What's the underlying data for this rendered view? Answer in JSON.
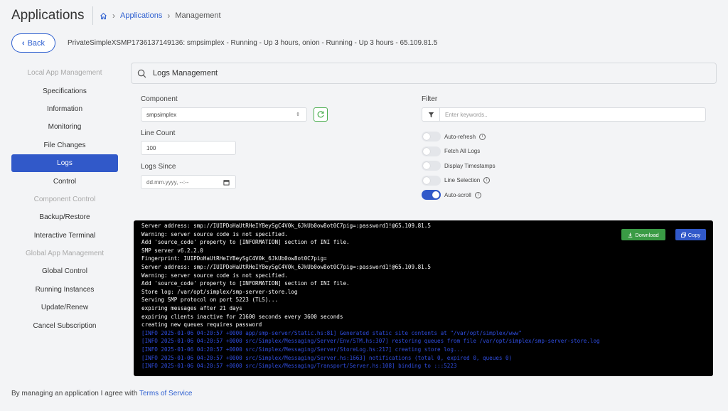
{
  "header": {
    "title": "Applications",
    "breadcrumb": {
      "link": "Applications",
      "current": "Management"
    }
  },
  "instance": {
    "back_label": "Back",
    "info": "PrivateSimpleXSMP1736137149136: smpsimplex - Running - Up 3 hours, onion - Running - Up 3 hours - 65.109.81.5"
  },
  "sidebar": {
    "items": [
      {
        "label": "Local App Management",
        "type": "header"
      },
      {
        "label": "Specifications",
        "type": "item"
      },
      {
        "label": "Information",
        "type": "item"
      },
      {
        "label": "Monitoring",
        "type": "item"
      },
      {
        "label": "File Changes",
        "type": "item"
      },
      {
        "label": "Logs",
        "type": "active"
      },
      {
        "label": "Control",
        "type": "item"
      },
      {
        "label": "Component Control",
        "type": "header"
      },
      {
        "label": "Backup/Restore",
        "type": "item"
      },
      {
        "label": "Interactive Terminal",
        "type": "item"
      },
      {
        "label": "Global App Management",
        "type": "header"
      },
      {
        "label": "Global Control",
        "type": "item"
      },
      {
        "label": "Running Instances",
        "type": "item"
      },
      {
        "label": "Update/Renew",
        "type": "item"
      },
      {
        "label": "Cancel Subscription",
        "type": "item"
      }
    ]
  },
  "logs": {
    "title": "Logs Management",
    "component_label": "Component",
    "component_value": "smpsimplex",
    "line_count_label": "Line Count",
    "line_count_value": "100",
    "logs_since_label": "Logs Since",
    "logs_since_placeholder": "dd.mm.yyyy, --:--",
    "filter_label": "Filter",
    "filter_placeholder": "Enter keywords..",
    "toggles": [
      {
        "label": "Auto-refresh",
        "on": false,
        "info": true
      },
      {
        "label": "Fetch All Logs",
        "on": false,
        "info": false
      },
      {
        "label": "Display Timestamps",
        "on": false,
        "info": false
      },
      {
        "label": "Line Selection",
        "on": false,
        "info": true
      },
      {
        "label": "Auto-scroll",
        "on": true,
        "info": true
      }
    ],
    "download_label": "Download",
    "copy_label": "Copy",
    "lines": [
      {
        "text": "Server address: smp://IUIPDoHaUtRHeIYBeySgC4V0k_6JkUb0ow8ot0C7pig=:password1!@65.109.81.5",
        "color": "white"
      },
      {
        "text": "Warning: server source code is not specified.",
        "color": "white"
      },
      {
        "text": "Add 'source_code' property to [INFORMATION] section of INI file.",
        "color": "white"
      },
      {
        "text": "SMP server v6.2.2.0",
        "color": "white"
      },
      {
        "text": "Fingerprint: IUIPDoHaUtRHeIYBeySgC4V0k_6JkUb0ow8ot0C7pig=",
        "color": "white"
      },
      {
        "text": "Server address: smp://IUIPDoHaUtRHeIYBeySgC4V0k_6JkUb0ow8ot0C7pig=:password1!@65.109.81.5",
        "color": "white"
      },
      {
        "text": "Warning: server source code is not specified.",
        "color": "white"
      },
      {
        "text": "Add 'source_code' property to [INFORMATION] section of INI file.",
        "color": "white"
      },
      {
        "text": "Store log: /var/opt/simplex/smp-server-store.log",
        "color": "white"
      },
      {
        "text": "Serving SMP protocol on port 5223 (TLS)...",
        "color": "white"
      },
      {
        "text": "expiring messages after 21 days",
        "color": "white"
      },
      {
        "text": "expiring clients inactive for 21600 seconds every 3600 seconds",
        "color": "white"
      },
      {
        "text": "creating new queues requires password",
        "color": "white"
      },
      {
        "text": "[INFO 2025-01-06 04:20:57 +0000 app/smp-server/Static.hs:81] Generated static site contents at \"/var/opt/simplex/www\"",
        "color": "blue"
      },
      {
        "text": "[INFO 2025-01-06 04:20:57 +0000 src/Simplex/Messaging/Server/Env/STM.hs:307] restoring queues from file /var/opt/simplex/smp-server-store.log",
        "color": "blue"
      },
      {
        "text": "[INFO 2025-01-06 04:20:57 +0000 src/Simplex/Messaging/Server/StoreLog.hs:217] creating store log...",
        "color": "blue"
      },
      {
        "text": "[INFO 2025-01-06 04:20:57 +0000 src/Simplex/Messaging/Server.hs:1663] notifications (total 0, expired 0, queues 0)",
        "color": "blue"
      },
      {
        "text": "[INFO 2025-01-06 04:20:57 +0000 src/Simplex/Messaging/Transport/Server.hs:108] binding to :::5223",
        "color": "blue"
      }
    ]
  },
  "footer": {
    "text": "By managing an application I agree with ",
    "tos_link": "Terms of Service"
  }
}
